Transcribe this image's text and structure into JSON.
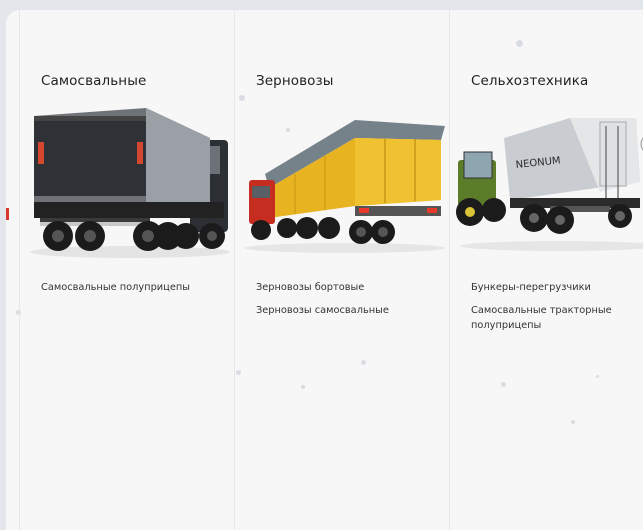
{
  "columns": [
    {
      "title": "Самосвальные",
      "image_icon": "dump-trailer-truck-image",
      "links": [
        "Самосвальные полуприцепы"
      ]
    },
    {
      "title": "Зерновозы",
      "image_icon": "grain-trailer-truck-image",
      "links": [
        "Зерновозы бортовые",
        "Зерновозы самосвальные"
      ]
    },
    {
      "title": "Сельхозтехника",
      "image_icon": "tractor-hopper-trailer-image",
      "links": [
        "Бункеры-перегрузчики",
        "Самосвальные тракторные полуприцепы"
      ]
    }
  ],
  "brand_text_on_trailer": "NEONUM",
  "colors": {
    "panel_bg": "#f7f7f7",
    "page_bg": "#e3e7ec",
    "grain_trailer_yellow": "#e8b321",
    "tractor_green": "#5b7d2a"
  }
}
